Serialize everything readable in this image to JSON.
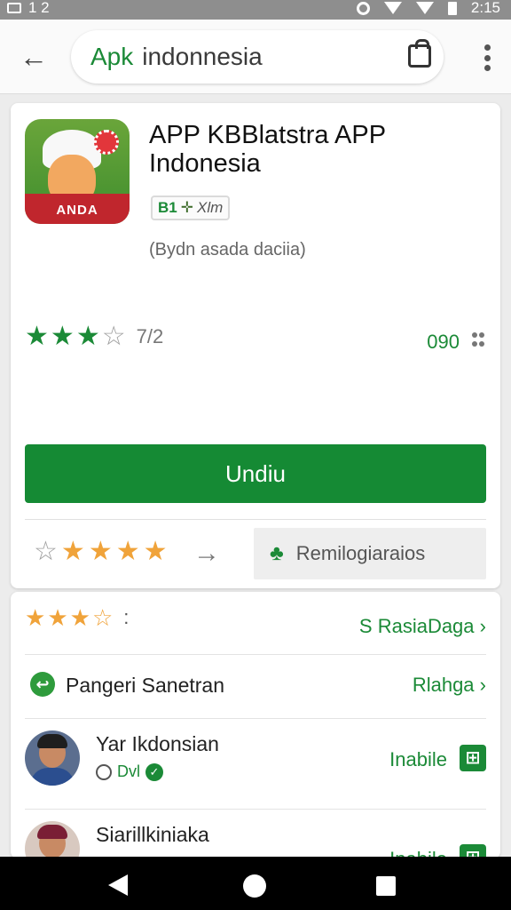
{
  "status_bar": {
    "left_text": "1 2",
    "time": "2:15"
  },
  "search": {
    "brand": "Apk",
    "query": "indonnesia"
  },
  "icons": {
    "back": "arrow-left-icon",
    "bag": "shopping-bag-icon",
    "more": "more-vert-icon"
  },
  "app": {
    "title": "APP KBBlatstra APP Indonesia",
    "badge_mark": "B1",
    "badge_text": "Xlm",
    "subtitle": "(Bydn asada daciia)",
    "icon_band_text": "ANDA",
    "rating_count": "7/2",
    "size": "090",
    "install_label": "Undiu",
    "wishlist_label": "Remilogiaraios"
  },
  "list": {
    "reviews_link": "S RasiaDaga",
    "similar_label": "Pangeri Sanetran",
    "similar_link": "Rlahga",
    "developer1_name": "Yar Ikdonsian",
    "developer1_sub": "Dvl",
    "developer1_link": "Inabile",
    "developer2_name": "Siarillkiniaka",
    "developer2_link": "Inabile"
  },
  "colors": {
    "brand_green": "#1b8a37",
    "star_orange": "#f0a33a",
    "icon_red": "#c0262d"
  }
}
